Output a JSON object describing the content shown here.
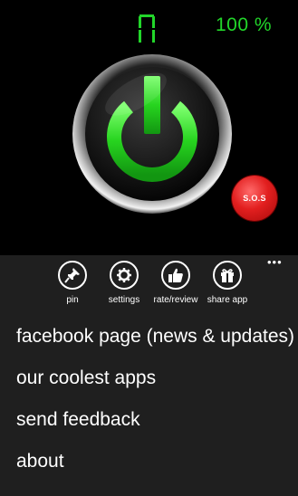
{
  "status": {
    "digit": "7",
    "battery": "100 %"
  },
  "sos": {
    "label": "S.O.S"
  },
  "colors": {
    "accent_green": "#22d62a",
    "sos_red": "#e21f1f",
    "appbar_bg": "#1f1f1f"
  },
  "appbar": {
    "buttons": [
      {
        "label": "pin",
        "icon": "pin-icon"
      },
      {
        "label": "settings",
        "icon": "gear-icon"
      },
      {
        "label": "rate/review",
        "icon": "thumbs-up-icon"
      },
      {
        "label": "share app",
        "icon": "gift-icon"
      }
    ],
    "more": "•••"
  },
  "menu": {
    "items": [
      "facebook page (news & updates)",
      "our coolest apps",
      "send feedback",
      "about"
    ]
  }
}
